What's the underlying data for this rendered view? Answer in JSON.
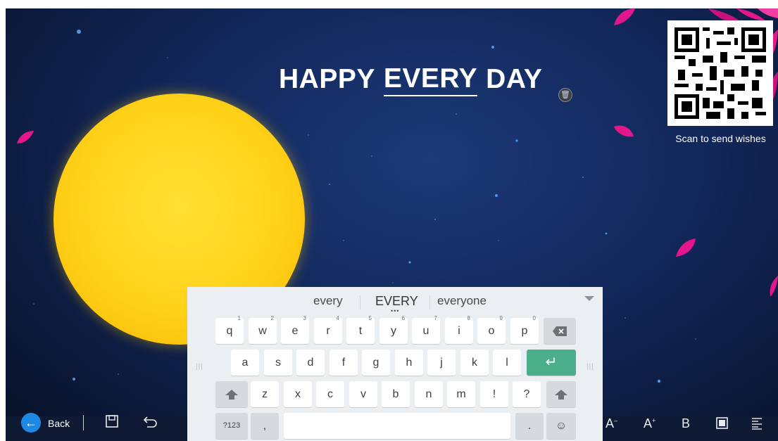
{
  "headline": {
    "word1": "HAPPY",
    "word2": "EVERY",
    "word3": "DAY"
  },
  "qr": {
    "caption": "Scan to send wishes"
  },
  "toolbar": {
    "back_label": "Back",
    "icons": [
      "back-arrow-icon",
      "save-icon",
      "undo-icon",
      "font-decrease-icon",
      "font-increase-icon",
      "bold-icon",
      "text-background-icon",
      "align-icon"
    ],
    "font_decrease_label": "A",
    "font_increase_label": "A",
    "bold_label": "B"
  },
  "keyboard": {
    "suggestions": [
      "every",
      "EVERY",
      "everyone"
    ],
    "row1": [
      {
        "key": "q",
        "hint": "1"
      },
      {
        "key": "w",
        "hint": "2"
      },
      {
        "key": "e",
        "hint": "3"
      },
      {
        "key": "r",
        "hint": "4"
      },
      {
        "key": "t",
        "hint": "5"
      },
      {
        "key": "y",
        "hint": "6"
      },
      {
        "key": "u",
        "hint": "7"
      },
      {
        "key": "i",
        "hint": "8"
      },
      {
        "key": "o",
        "hint": "9"
      },
      {
        "key": "p",
        "hint": "0"
      }
    ],
    "row2": [
      "a",
      "s",
      "d",
      "f",
      "g",
      "h",
      "j",
      "k",
      "l"
    ],
    "row3": [
      "z",
      "x",
      "c",
      "v",
      "b",
      "n",
      "m",
      "!",
      "?"
    ],
    "bottom": {
      "symbols_label": "?123",
      "comma": ",",
      "period": "."
    },
    "accent_color": "#4caf8c"
  },
  "colors": {
    "sun": "#ffd21a",
    "petal": "#e3168c",
    "background": "#12275a"
  }
}
